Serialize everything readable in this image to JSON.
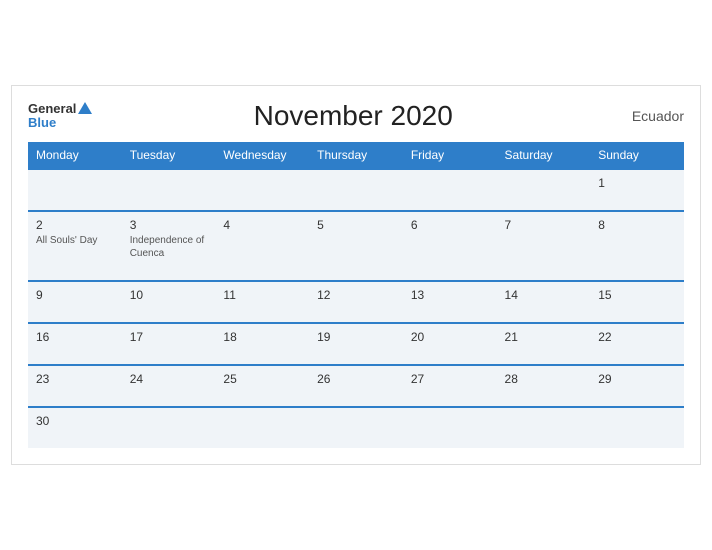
{
  "header": {
    "logo_general": "General",
    "logo_blue": "Blue",
    "title": "November 2020",
    "country": "Ecuador"
  },
  "weekdays": [
    "Monday",
    "Tuesday",
    "Wednesday",
    "Thursday",
    "Friday",
    "Saturday",
    "Sunday"
  ],
  "weeks": [
    [
      {
        "day": "",
        "events": []
      },
      {
        "day": "",
        "events": []
      },
      {
        "day": "",
        "events": []
      },
      {
        "day": "",
        "events": []
      },
      {
        "day": "",
        "events": []
      },
      {
        "day": "",
        "events": []
      },
      {
        "day": "1",
        "events": []
      }
    ],
    [
      {
        "day": "2",
        "events": [
          "All Souls' Day"
        ]
      },
      {
        "day": "3",
        "events": [
          "Independence of Cuenca"
        ]
      },
      {
        "day": "4",
        "events": []
      },
      {
        "day": "5",
        "events": []
      },
      {
        "day": "6",
        "events": []
      },
      {
        "day": "7",
        "events": []
      },
      {
        "day": "8",
        "events": []
      }
    ],
    [
      {
        "day": "9",
        "events": []
      },
      {
        "day": "10",
        "events": []
      },
      {
        "day": "11",
        "events": []
      },
      {
        "day": "12",
        "events": []
      },
      {
        "day": "13",
        "events": []
      },
      {
        "day": "14",
        "events": []
      },
      {
        "day": "15",
        "events": []
      }
    ],
    [
      {
        "day": "16",
        "events": []
      },
      {
        "day": "17",
        "events": []
      },
      {
        "day": "18",
        "events": []
      },
      {
        "day": "19",
        "events": []
      },
      {
        "day": "20",
        "events": []
      },
      {
        "day": "21",
        "events": []
      },
      {
        "day": "22",
        "events": []
      }
    ],
    [
      {
        "day": "23",
        "events": []
      },
      {
        "day": "24",
        "events": []
      },
      {
        "day": "25",
        "events": []
      },
      {
        "day": "26",
        "events": []
      },
      {
        "day": "27",
        "events": []
      },
      {
        "day": "28",
        "events": []
      },
      {
        "day": "29",
        "events": []
      }
    ],
    [
      {
        "day": "30",
        "events": []
      },
      {
        "day": "",
        "events": []
      },
      {
        "day": "",
        "events": []
      },
      {
        "day": "",
        "events": []
      },
      {
        "day": "",
        "events": []
      },
      {
        "day": "",
        "events": []
      },
      {
        "day": "",
        "events": []
      }
    ]
  ]
}
